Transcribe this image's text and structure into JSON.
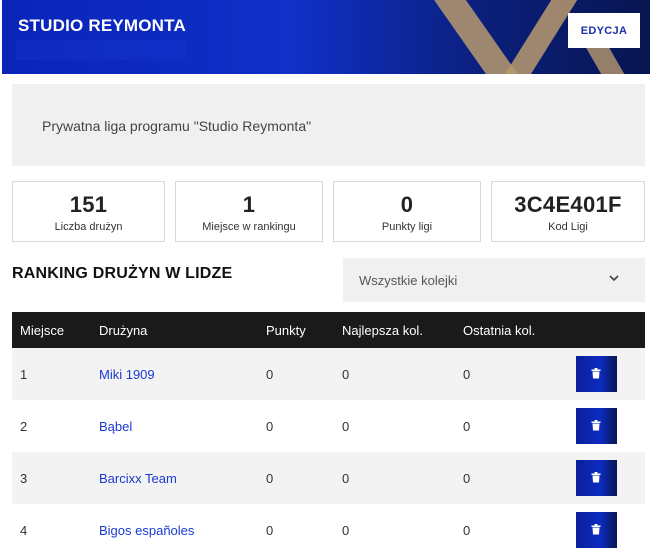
{
  "header": {
    "title": "STUDIO REYMONTA",
    "edit_label": "EDYCJA"
  },
  "info": {
    "text": "Prywatna liga programu \"Studio Reymonta\""
  },
  "stats": [
    {
      "value": "151",
      "label": "Liczba drużyn"
    },
    {
      "value": "1",
      "label": "Miejsce w rankingu"
    },
    {
      "value": "0",
      "label": "Punkty ligi"
    },
    {
      "value": "3C4E401F",
      "label": "Kod Ligi"
    }
  ],
  "ranking": {
    "title": "RANKING DRUŻYN W LIDZE",
    "filter_value": "Wszystkie kolejki",
    "columns": [
      "Miejsce",
      "Drużyna",
      "Punkty",
      "Najlepsza kol.",
      "Ostatnia kol."
    ],
    "rows": [
      {
        "place": "1",
        "team": "Miki 1909",
        "points": "0",
        "best": "0",
        "last": "0"
      },
      {
        "place": "2",
        "team": "Bąbel",
        "points": "0",
        "best": "0",
        "last": "0"
      },
      {
        "place": "3",
        "team": "Barcixx Team",
        "points": "0",
        "best": "0",
        "last": "0"
      },
      {
        "place": "4",
        "team": "Bigos españoles",
        "points": "0",
        "best": "0",
        "last": "0"
      }
    ]
  },
  "icons": {
    "delete": "trash-icon",
    "dropdown": "chevron-down-icon"
  },
  "colors": {
    "brand": "#0a24b8",
    "accent_gold": "#b99a6e",
    "link": "#1a3ad0"
  }
}
